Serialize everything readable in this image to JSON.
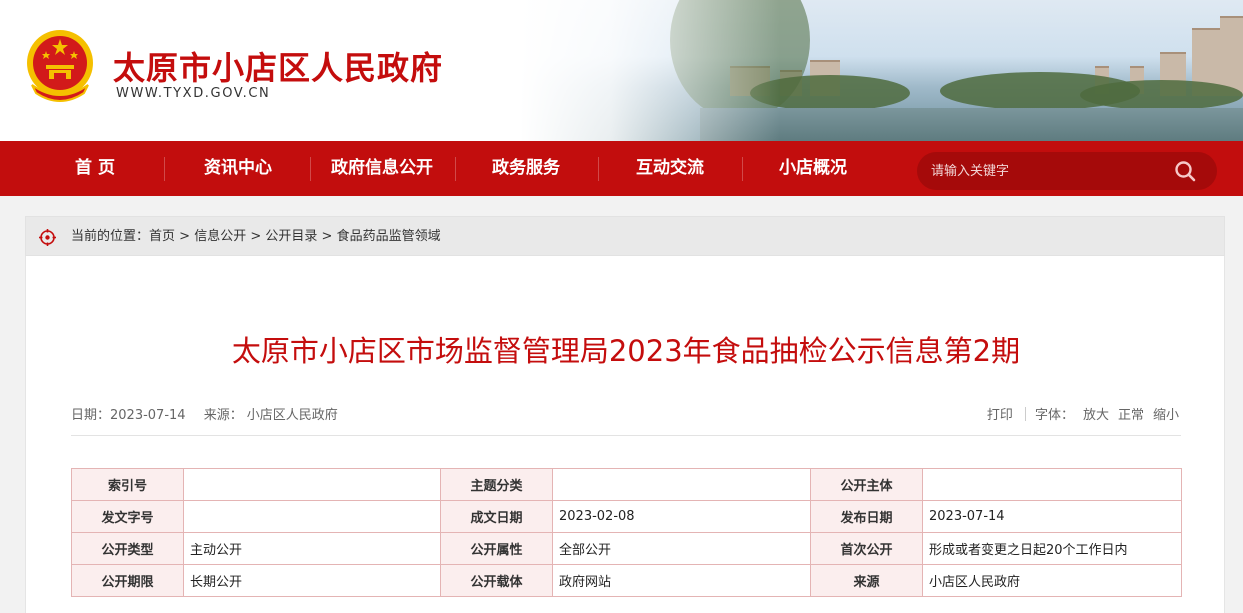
{
  "header": {
    "site_title": "太原市小店区人民政府",
    "site_url": "WWW.TYXD.GOV.CN"
  },
  "nav": {
    "items": [
      "首 页",
      "资讯中心",
      "政府信息公开",
      "政务服务",
      "互动交流",
      "小店概况"
    ],
    "search_placeholder": "请输入关键字"
  },
  "breadcrumb": {
    "prefix": "当前的位置：",
    "items": [
      "首页",
      "信息公开",
      "公开目录",
      "食品药品监管领域"
    ],
    "separator": " > "
  },
  "article": {
    "title": "太原市小店区市场监督管理局2023年食品抽检公示信息第2期",
    "date_label": "日期：",
    "date": "2023-07-14",
    "source_label": "来源：",
    "source": "小店区人民政府",
    "print_label": "打印",
    "font_label": "字体：",
    "font_large": "放大",
    "font_normal": "正常",
    "font_small": "缩小"
  },
  "info_table": {
    "rows": [
      [
        {
          "k": "索引号",
          "v": ""
        },
        {
          "k": "主题分类",
          "v": ""
        },
        {
          "k": "公开主体",
          "v": ""
        }
      ],
      [
        {
          "k": "发文字号",
          "v": ""
        },
        {
          "k": "成文日期",
          "v": "2023-02-08"
        },
        {
          "k": "发布日期",
          "v": "2023-07-14"
        }
      ],
      [
        {
          "k": "公开类型",
          "v": "主动公开"
        },
        {
          "k": "公开属性",
          "v": "全部公开"
        },
        {
          "k": "首次公开",
          "v": "形成或者变更之日起20个工作日内"
        }
      ],
      [
        {
          "k": "公开期限",
          "v": "长期公开"
        },
        {
          "k": "公开载体",
          "v": "政府网站"
        },
        {
          "k": "来源",
          "v": "小店区人民政府"
        }
      ]
    ]
  },
  "colors": {
    "brand_red": "#c20d0d",
    "title_red": "#c40d0d",
    "search_bg": "#a50a0a"
  }
}
